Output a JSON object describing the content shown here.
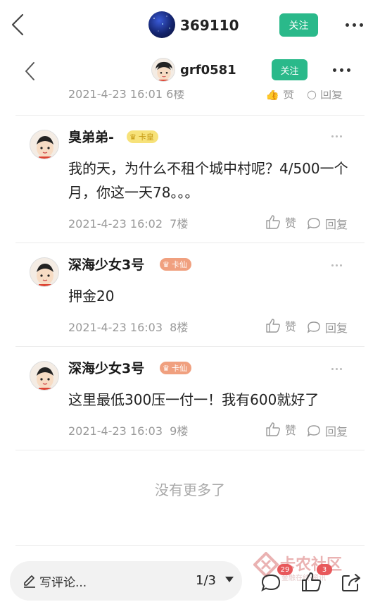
{
  "header": {
    "username": "369110",
    "follow_label": "关注"
  },
  "subheader": {
    "username": "grf0581",
    "follow_label": "关注"
  },
  "cutoff": {
    "meta": "2021-4-23 16:01  6楼",
    "like_label": "赞",
    "reply_label": "回复"
  },
  "comments": [
    {
      "username": "臭弟弟-",
      "badge": "卡皇",
      "text": "我的天，为什么不租个城中村呢？4/500一个月，你这一天78。。。",
      "time": "2021-4-23 16:02",
      "floor": "7楼",
      "like_label": "赞",
      "reply_label": "回复"
    },
    {
      "username": "深海少女3号",
      "badge": "卡仙",
      "text": "押金20",
      "time": "2021-4-23 16:03",
      "floor": "8楼",
      "like_label": "赞",
      "reply_label": "回复"
    },
    {
      "username": "深海少女3号",
      "badge": "卡仙",
      "text": "这里最低300压一付一！我有600就好了",
      "time": "2021-4-23 16:03",
      "floor": "9楼",
      "like_label": "赞",
      "reply_label": "回复"
    }
  ],
  "no_more_label": "没有更多了",
  "bottom": {
    "comment_placeholder": "写评论...",
    "page_indicator": "1/3",
    "comment_count": "29",
    "like_count": "3"
  },
  "watermark": {
    "title": "卡农社区",
    "subtitle": "金融在线·资讯"
  },
  "colors": {
    "accent": "#2ab98a",
    "badge_gold": "#f7e27a",
    "badge_orange": "#f0a07f",
    "count_red": "#e8585b"
  }
}
